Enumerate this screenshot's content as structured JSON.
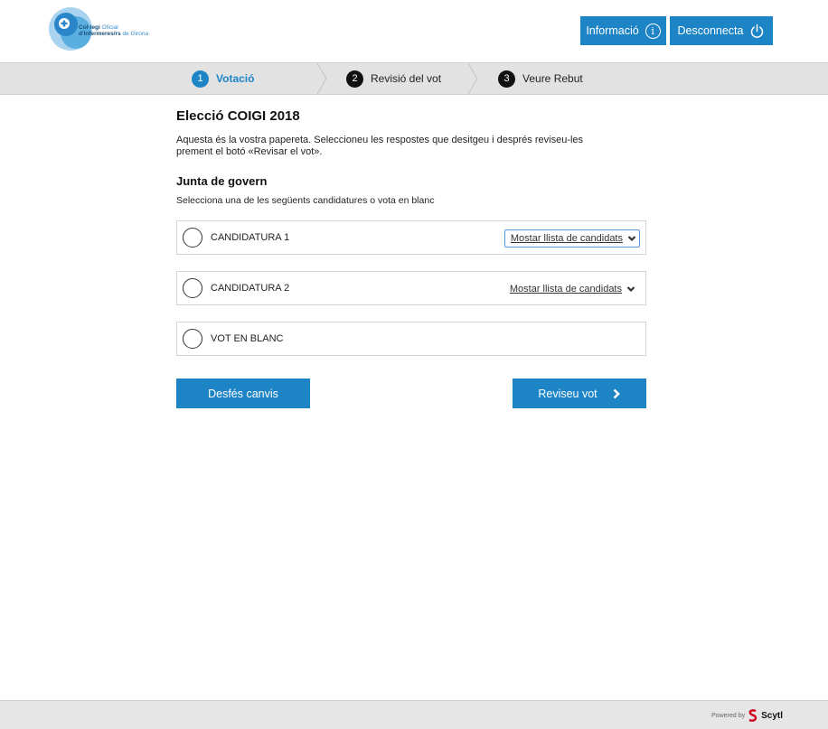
{
  "header": {
    "logo": {
      "line1_bold": "Col·legi",
      "line1_light": "Oficial",
      "line2_bold": "d'Infermeres/rs",
      "line2_light": "de Girona"
    },
    "info_label": "Informació",
    "logout_label": "Desconnecta"
  },
  "steps": [
    {
      "num": "1",
      "label": "Votació"
    },
    {
      "num": "2",
      "label": "Revisió del vot"
    },
    {
      "num": "3",
      "label": "Veure Rebut"
    }
  ],
  "main": {
    "title": "Elecció COIGI 2018",
    "intro_line1": "Aquesta és la vostra papereta. Seleccioneu les respostes que desitgeu i després reviseu-les",
    "intro_line2": "prement el botó «Revisar el vot».",
    "section_title": "Junta de govern",
    "instruction": "Selecciona una de les següents candidatures o vota en blanc",
    "options": [
      {
        "label": "CANDIDATURA 1",
        "show_list": "Mostar llista de candidats"
      },
      {
        "label": "CANDIDATURA 2",
        "show_list": "Mostar llista de candidats"
      },
      {
        "label": "VOT EN BLANC"
      }
    ],
    "undo_label": "Desfés canvis",
    "review_label": "Reviseu vot"
  },
  "footer": {
    "powered_by": "Powered by",
    "brand": "Scytl"
  },
  "colors": {
    "accent": "#1d84c6",
    "steps_bg": "#e2e2e2",
    "footer_bg": "#e6e6e6"
  }
}
